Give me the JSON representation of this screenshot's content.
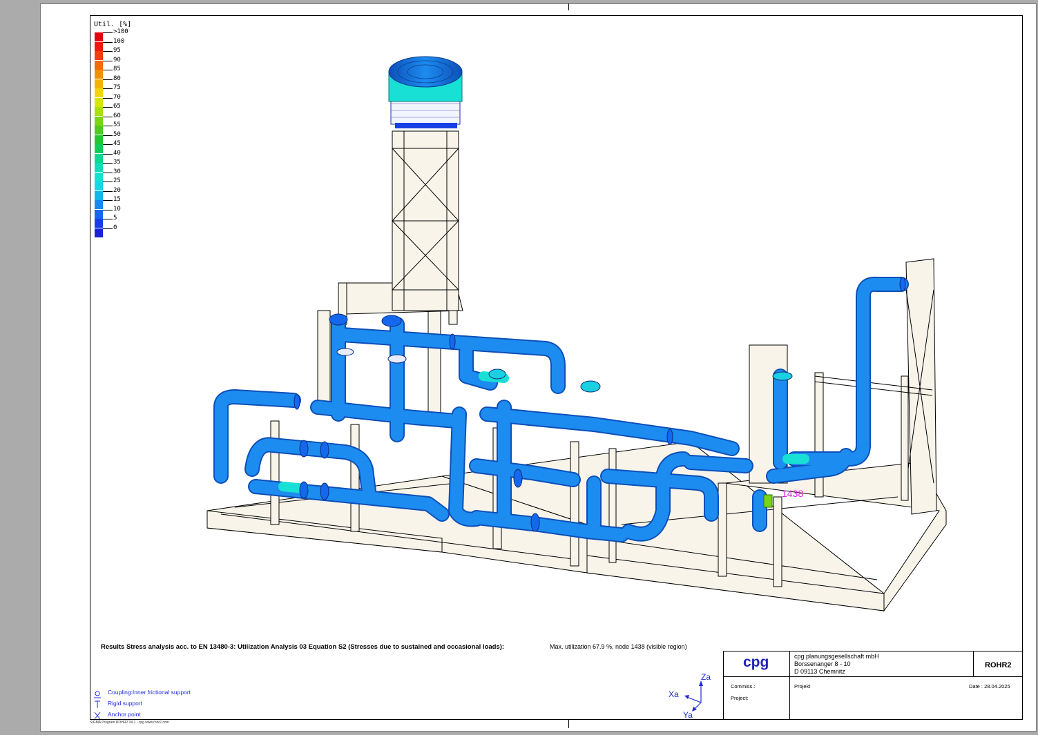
{
  "legend": {
    "title": "Util. [%]",
    "items": [
      {
        "label": ">100",
        "color": "#e0000f"
      },
      {
        "label": "100",
        "color": "#f01a0a"
      },
      {
        "label": "95",
        "color": "#f2400a"
      },
      {
        "label": "90",
        "color": "#f36c0a"
      },
      {
        "label": "85",
        "color": "#f48f0a"
      },
      {
        "label": "80",
        "color": "#f6b00a"
      },
      {
        "label": "75",
        "color": "#f2d40a"
      },
      {
        "label": "70",
        "color": "#d6e60a"
      },
      {
        "label": "65",
        "color": "#a9e010"
      },
      {
        "label": "60",
        "color": "#7ad41a"
      },
      {
        "label": "55",
        "color": "#4ccc20"
      },
      {
        "label": "50",
        "color": "#22c82e"
      },
      {
        "label": "45",
        "color": "#12cc5a"
      },
      {
        "label": "40",
        "color": "#10d690"
      },
      {
        "label": "35",
        "color": "#14dcb8"
      },
      {
        "label": "30",
        "color": "#18e0d0"
      },
      {
        "label": "25",
        "color": "#18d6e8"
      },
      {
        "label": "20",
        "color": "#14b4ee"
      },
      {
        "label": "15",
        "color": "#128cf0"
      },
      {
        "label": "10",
        "color": "#1468ee"
      },
      {
        "label": "5",
        "color": "#1640e6"
      },
      {
        "label": "0",
        "color": "#1a22dc"
      }
    ]
  },
  "model": {
    "node_label": "1438",
    "pipe_color": "#1d8cf0",
    "pipe_dark": "#0d4fb8",
    "pipe_light": "#19e0d4",
    "structure_fill": "#f8f4ea",
    "node_color": "#e020e0"
  },
  "result": {
    "title": "Results Stress analysis acc. to EN 13480-3: Utilization Analysis 03  Equation S2 (Stresses due to sustained and occasional loads):",
    "max_util": "Max. utilization 67.9 %, node 1438 (visible region)"
  },
  "symbols": [
    {
      "label": "Coupling:Inner frictional support",
      "icon": "coupling-icon"
    },
    {
      "label": "Rigid support",
      "icon": "rigid-support-icon"
    },
    {
      "label": "Anchor point",
      "icon": "anchor-point-icon"
    }
  ],
  "axes": {
    "x": "Xa",
    "y": "Ya",
    "z": "Za"
  },
  "footer": "SIGMA Program ROHR2 34.1 - cpg      www.rohr2.com",
  "titleblock": {
    "logo": "cpg",
    "company_name": "cpg planungsgesellschaft mbH",
    "address1": "Borssenanger 8 - 10",
    "address2": "D 09113 Chemnitz",
    "program": "ROHR2",
    "commiss_label": "Commiss.:",
    "project_label": "Project:",
    "projekt": "Projekt",
    "date_label": "Date :",
    "date": "28.04.2025"
  }
}
